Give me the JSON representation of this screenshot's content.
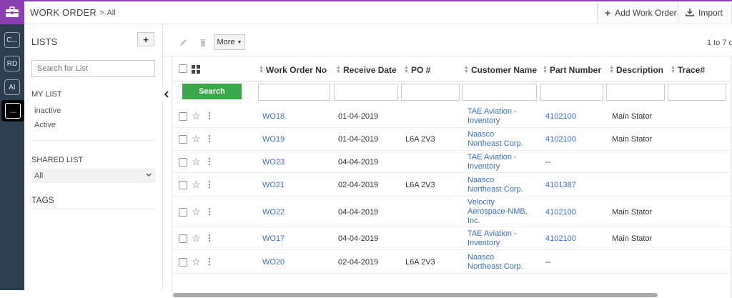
{
  "nav": {
    "rail_items": [
      "C...",
      "RD",
      "AI",
      "..."
    ]
  },
  "header": {
    "title": "WORK ORDER",
    "separator": ">",
    "crumb": "All",
    "add_label": "Add Work Order",
    "import_label": "Import"
  },
  "sidebar": {
    "lists_title": "LISTS",
    "add_symbol": "+",
    "search_placeholder": "Search for List",
    "my_list_title": "MY LIST",
    "my_list_items": [
      "inactive",
      "Active"
    ],
    "shared_list_title": "SHARED LIST",
    "shared_selected": "All",
    "tags_title": "TAGS"
  },
  "toolbar": {
    "more_label": "More",
    "pager": "1 to 7  o"
  },
  "table": {
    "columns": [
      "Work Order No",
      "Receive Date",
      "PO #",
      "Customer Name",
      "Part Number",
      "Description",
      "Trace#"
    ],
    "search_label": "Search",
    "rows": [
      {
        "wo": "WO18",
        "date": "01-04-2019",
        "po": "",
        "customer": [
          "TAE Aviation -",
          "Inventory"
        ],
        "part": "4102100",
        "desc": "Main Stator"
      },
      {
        "wo": "WO19",
        "date": "01-04-2019",
        "po": "L6A 2V3",
        "customer": [
          "Naasco",
          "Northeast Corp."
        ],
        "part": "4102100",
        "desc": "Main Stator"
      },
      {
        "wo": "WO23",
        "date": "04-04-2019",
        "po": "",
        "customer": [
          "TAE Aviation -",
          "Inventory"
        ],
        "part": "--",
        "desc": ""
      },
      {
        "wo": "WO21",
        "date": "02-04-2019",
        "po": "L6A 2V3",
        "customer": [
          "Naasco",
          "Northeast Corp."
        ],
        "part": "4101387",
        "desc": ""
      },
      {
        "wo": "WO22",
        "date": "04-04-2019",
        "po": "",
        "customer": [
          "Velocity",
          "Aerospace-NMB,",
          "Inc."
        ],
        "part": "4102100",
        "desc": "Main Stator"
      },
      {
        "wo": "WO17",
        "date": "04-04-2019",
        "po": "",
        "customer": [
          "TAE Aviation -",
          "Inventory"
        ],
        "part": "4102100",
        "desc": "Main Stator"
      },
      {
        "wo": "WO20",
        "date": "02-04-2019",
        "po": "L6A 2V3",
        "customer": [
          "Naasco",
          "Northeast Corp."
        ],
        "part": "--",
        "desc": ""
      }
    ]
  },
  "colors": {
    "brand": "#8b3fb0",
    "rail": "#2c3e50",
    "search_button": "#3aa84a",
    "link": "#3a6fc4"
  }
}
